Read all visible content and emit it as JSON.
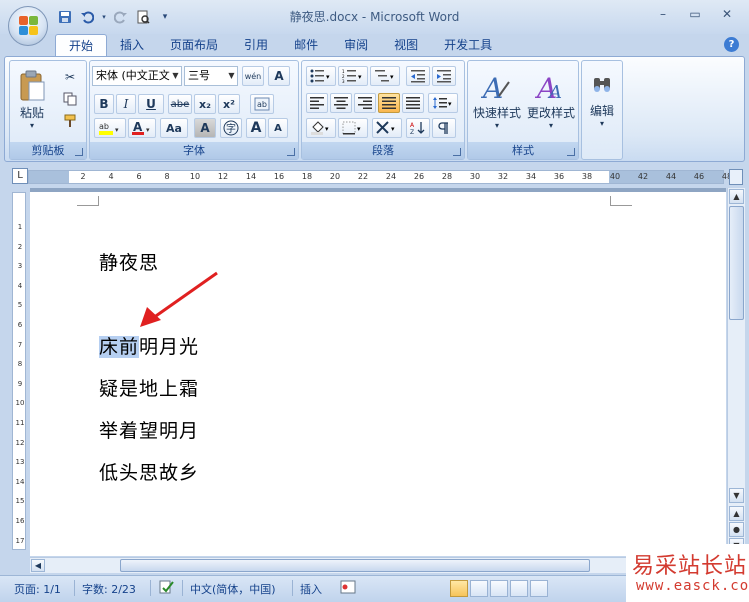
{
  "window": {
    "title": "静夜思.docx - Microsoft Word",
    "controls": [
      "–",
      "▭",
      "✕"
    ]
  },
  "qat": [
    "💾",
    "↶",
    "↻",
    "🖨",
    "▾"
  ],
  "tabs": [
    "开始",
    "插入",
    "页面布局",
    "引用",
    "邮件",
    "审阅",
    "视图",
    "开发工具"
  ],
  "active_tab": "开始",
  "ribbon": {
    "clipboard": {
      "label": "剪贴板",
      "paste": "粘贴"
    },
    "font": {
      "label": "字体",
      "font_name": "宋体 (中文正文",
      "font_size": "三号",
      "bold": "B",
      "italic": "I",
      "underline": "U",
      "strike": "abe",
      "sub": "x₂",
      "sup": "x²",
      "grow": "A",
      "shrink": "A",
      "aa": "Aa",
      "clear": "A"
    },
    "paragraph": {
      "label": "段落"
    },
    "styles": {
      "label": "样式",
      "quick": "快速样式",
      "change": "更改样式"
    },
    "editing": {
      "label": "编辑"
    }
  },
  "ruler": {
    "corner": "L",
    "ticks": [
      "2",
      "4",
      "6",
      "8",
      "10",
      "12",
      "14",
      "16",
      "18",
      "20",
      "22",
      "24",
      "26",
      "28",
      "30",
      "32",
      "34",
      "36",
      "38",
      "40",
      "42",
      "44",
      "46",
      "48"
    ]
  },
  "vruler": {
    "ticks": [
      "1",
      "2",
      "3",
      "4",
      "5",
      "6",
      "7",
      "8",
      "9",
      "10",
      "11",
      "12",
      "13",
      "14",
      "15",
      "16",
      "17"
    ]
  },
  "document": {
    "title_line": "静夜思",
    "line1_selected": "床前",
    "line1_rest": "明月光",
    "line2": "疑是地上霜",
    "line3": "举着望明月",
    "line4": "低头思故乡"
  },
  "status": {
    "page": "页面: 1/1",
    "words": "字数: 2/23",
    "language": "中文(简体，中国)",
    "mode": "插入"
  },
  "watermark": {
    "cn": "易采站长站",
    "url": "www.easck.com"
  },
  "colors": {
    "accent": "#15428b",
    "selection": "#b6cff1",
    "arrow": "#e02020"
  }
}
